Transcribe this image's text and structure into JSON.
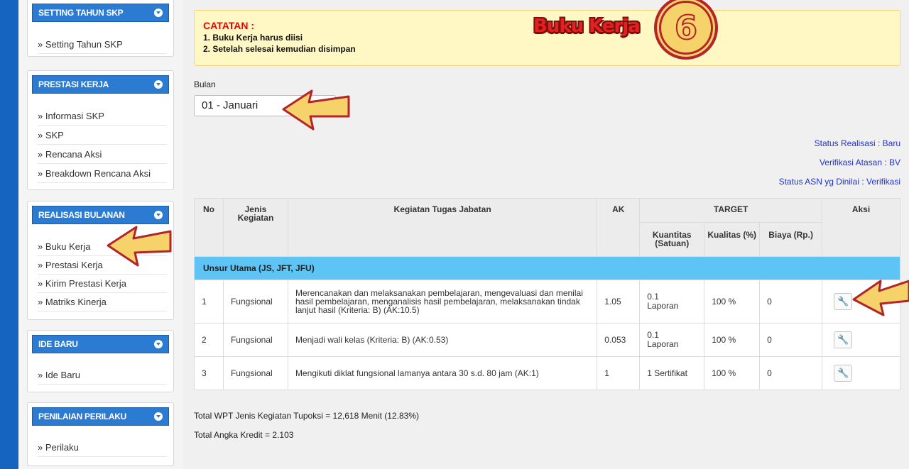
{
  "sidebar": {
    "panels": [
      {
        "title": "SETTING TAHUN SKP",
        "items": [
          "» Setting Tahun SKP"
        ]
      },
      {
        "title": "PRESTASI KERJA",
        "items": [
          "» Informasi SKP",
          "» SKP",
          "» Rencana Aksi",
          "» Breakdown Rencana Aksi"
        ]
      },
      {
        "title": "REALISASI BULANAN",
        "items": [
          "» Buku Kerja",
          "» Prestasi Kerja",
          "» Kirim Prestasi Kerja",
          "» Matriks Kinerja"
        ]
      },
      {
        "title": "IDE BARU",
        "items": [
          "» Ide Baru"
        ]
      },
      {
        "title": "PENILAIAN PERILAKU",
        "items": [
          "» Perilaku"
        ]
      }
    ]
  },
  "notice": {
    "title": "CATATAN :",
    "lines": [
      "1. Buku Kerja harus diisi",
      "2. Setelah selesai kemudian disimpan"
    ]
  },
  "overlay": {
    "page_label": "Buku Kerja",
    "step_number": "6"
  },
  "bulan": {
    "label": "Bulan",
    "selected": "01 - Januari"
  },
  "status": {
    "realisasi": "Status Realisasi : Baru",
    "verifikasi": "Verifikasi Atasan : BV",
    "asn": "Status ASN yg Dinilai : Verifikasi"
  },
  "table": {
    "headers": {
      "no": "No",
      "jenis": "Jenis Kegiatan",
      "kegiatan": "Kegiatan Tugas Jabatan",
      "ak": "AK",
      "target": "TARGET",
      "kuantitas": "Kuantitas (Satuan)",
      "kualitas": "Kualitas (%)",
      "biaya": "Biaya (Rp.)",
      "aksi": "Aksi"
    },
    "section": "Unsur Utama (JS, JFT, JFU)",
    "rows": [
      {
        "no": "1",
        "jenis": "Fungsional",
        "kegiatan": "Merencanakan dan melaksanakan pembelajaran, mengevaluasi dan menilai hasil pembelajaran, menganalisis hasil pembelajaran, melaksanakan tindak lanjut hasil (Kriteria: B) (AK:10.5)",
        "ak": "1.05",
        "kuantitas_value": "0.1",
        "kuantitas_unit": "Laporan",
        "kualitas": "100 %",
        "biaya": "0"
      },
      {
        "no": "2",
        "jenis": "Fungsional",
        "kegiatan": "Menjadi wali kelas (Kriteria: B) (AK:0.53)",
        "ak": "0.053",
        "kuantitas_value": "0.1",
        "kuantitas_unit": "Laporan",
        "kualitas": "100 %",
        "biaya": "0"
      },
      {
        "no": "3",
        "jenis": "Fungsional",
        "kegiatan": "Mengikuti diklat fungsional lamanya antara 30 s.d. 80 jam (AK:1)",
        "ak": "1",
        "kuantitas_value": "1 Sertifikat",
        "kuantitas_unit": "",
        "kualitas": "100 %",
        "biaya": "0"
      }
    ]
  },
  "totals": {
    "wpt": "Total WPT Jenis Kegiatan Tupoksi = 12,618 Menit (12.83%)",
    "ak": "Total Angka Kredit = 2.103"
  },
  "colors": {
    "accent": "#2b7bd3",
    "section": "#5ec4f5",
    "notice_bg": "#fff8c4",
    "arrow_fill": "#f6d36a",
    "arrow_stroke": "#b3252a"
  },
  "icons": {
    "panel_toggle": "chevron-down-circle-icon",
    "aksi": "wrench-icon",
    "annotation": "arrow-pointer-icon"
  }
}
